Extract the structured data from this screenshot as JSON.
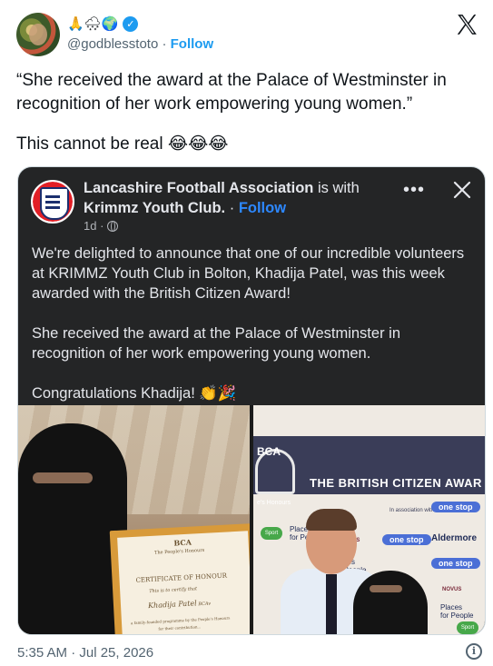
{
  "tweet": {
    "author_emojis": "🙏🌨🌍",
    "verified_mark": "✓",
    "handle": "@godblesstoto",
    "separator": " · ",
    "follow_label": "Follow",
    "quote_text": "“She received the award at the Palace of Westminster in recognition of her work empowering young women.”",
    "comment_text": "This cannot be real 😂😂😂",
    "timestamp": "5:35 AM · Jul 25, 2026",
    "info_label": "i"
  },
  "embedded_post": {
    "page_name": "Lancashire Football Association",
    "with_text": " is with ",
    "tagged_name": "Krimmz Youth Club.",
    "separator": " · ",
    "follow_label": "Follow",
    "age": "1d ·",
    "more_label": "•••",
    "body_para1": "We're delighted to announce that one of our incredible volunteers at KRIMMZ Youth Club in Bolton, Khadija Patel, was this week awarded with the British Citizen Award!",
    "body_para2": "She received the award at the Palace of Westminster in recognition of her work empowering young women.",
    "body_para3": "Congratulations Khadija! 👏🎉"
  },
  "photos": {
    "left": {
      "cert_org": "BCA",
      "cert_sub": "The People's Honours",
      "cert_title": "CERTIFICATE OF HONOUR",
      "cert_line": "This is to certify that",
      "cert_name": "Khadija Patel",
      "cert_name_suffix": " BCAv",
      "cert_small1": "a family-founded programme by the People's Honours",
      "cert_small2": "for their contribution..."
    },
    "right": {
      "banner_prefix": "BCA",
      "banner_title": "THE BRITISH CITIZEN AWAR",
      "banner_sub": "e's Honours",
      "assoc": "In association with",
      "onestop": "one stop",
      "aldermore": "Aldermore",
      "places": "Places\nfor People",
      "novus": "NOVUS",
      "green_badge": "Sport"
    }
  },
  "colors": {
    "accent": "#1d9bf0",
    "fb_follow": "#2d88ff",
    "card_bg": "#242526",
    "muted": "#536471"
  }
}
